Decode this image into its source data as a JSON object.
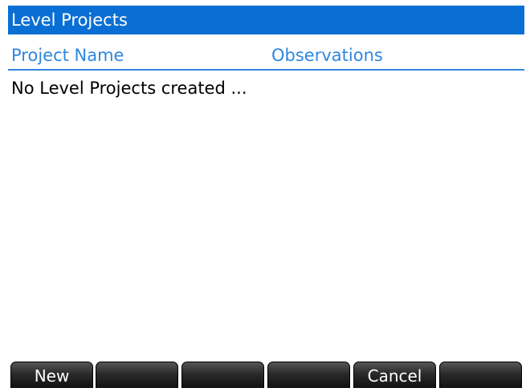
{
  "title": "Level Projects",
  "columns": {
    "project_name": "Project Name",
    "observations": "Observations"
  },
  "empty_message": "No Level Projects created ...",
  "softkeys": [
    "New",
    "",
    "",
    "",
    "Cancel",
    ""
  ],
  "colors": {
    "title_bar": "#0a6fd4",
    "header_text": "#2f86df",
    "softkey_bg": "#1c1c1c"
  }
}
